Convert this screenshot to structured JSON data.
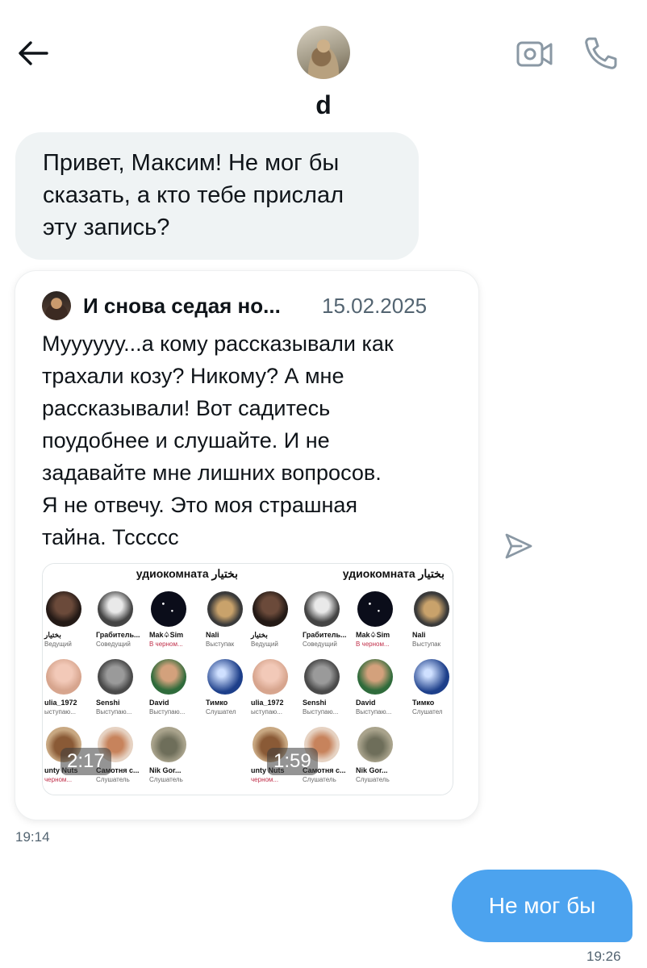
{
  "header": {
    "contact_name": "d",
    "icons": {
      "back": "arrow-left-icon",
      "video": "video-camera-icon",
      "phone": "phone-icon"
    }
  },
  "messages": {
    "incoming": {
      "text": "Привет, Максим! Не мог бы\nсказать, а кто тебе прислал\nэту запись?"
    },
    "quote": {
      "author": "И снова седая но...",
      "date": "15.02.2025",
      "text": "Муууууу...а кому рассказывали как\nтрахали козу? Никому? А мне\nрассказывали! Вот садитесь\nпоудобнее и слушайте. И не\nзадавайте мне лишних вопросов.\nЯ не отвечу. Это моя страшная\nтайна. Тссссс",
      "videos": [
        {
          "duration": "2:17",
          "room_title": "удиокомната بختیار",
          "participants": [
            {
              "name": "بختیار",
              "role": "Ведущий"
            },
            {
              "name": "Грабитель...",
              "role": "Соведущий"
            },
            {
              "name": "Mak♤Sim",
              "role": "В черном..."
            },
            {
              "name": "Nali",
              "role": "Выступак"
            },
            {
              "name": "ulia_1972",
              "role": "ыступаю..."
            },
            {
              "name": "Senshi",
              "role": "Выступаю..."
            },
            {
              "name": "David",
              "role": "Выступаю..."
            },
            {
              "name": "Тимко",
              "role": "Слушател"
            },
            {
              "name": "unty Nuts",
              "role": "черном..."
            },
            {
              "name": "Самотня с...",
              "role": "Слушатель"
            },
            {
              "name": "Nik Gor...",
              "role": "Слушатель"
            }
          ]
        },
        {
          "duration": "1:59",
          "room_title": "удиокомната بختیار",
          "participants": [
            {
              "name": "بختیار",
              "role": "Ведущий"
            },
            {
              "name": "Грабитель...",
              "role": "Соведущий"
            },
            {
              "name": "Mak♤Sim",
              "role": "В черном..."
            },
            {
              "name": "Nali",
              "role": "Выступак"
            },
            {
              "name": "ulia_1972",
              "role": "ыступаю..."
            },
            {
              "name": "Senshi",
              "role": "Выступаю..."
            },
            {
              "name": "David",
              "role": "Выступаю..."
            },
            {
              "name": "Тимко",
              "role": "Слушател"
            },
            {
              "name": "unty Nuts",
              "role": "черном..."
            },
            {
              "name": "Самотня с...",
              "role": "Слушатель"
            },
            {
              "name": "Nik Gor...",
              "role": "Слушатель"
            }
          ]
        }
      ]
    },
    "incoming_time": "19:14",
    "outgoing": {
      "text": "Не мог бы",
      "time": "19:26"
    }
  },
  "colors": {
    "outgoing_bubble": "#4ca3ef",
    "incoming_bubble": "#eff3f4",
    "secondary_text": "#536471"
  }
}
